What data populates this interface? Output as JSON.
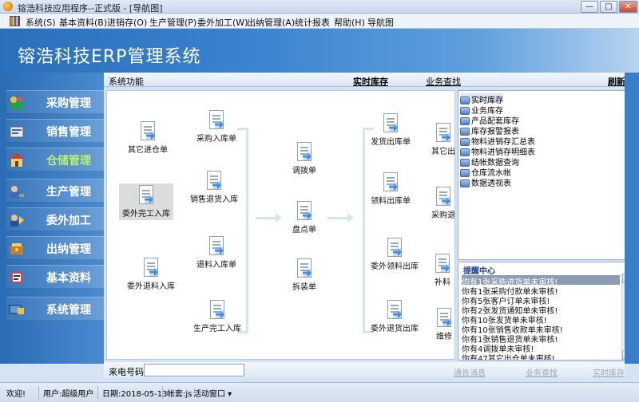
{
  "window": {
    "title": "镕浩科技应用程序--正式版 - [导航图]",
    "btn_min": "—",
    "btn_max": "□",
    "btn_close": "✕"
  },
  "menu": [
    "系统(S)",
    "基本资料(B)",
    "进销存(O)",
    "生产管理(P)",
    "委外加工(W)",
    "出纳管理(A)",
    "统计报表",
    "帮助(H)",
    "导航图"
  ],
  "banner": {
    "title": "镕浩科技ERP管理系统"
  },
  "sidebar": {
    "items": [
      {
        "label": "采购管理",
        "icon": "purchase-icon"
      },
      {
        "label": "销售管理",
        "icon": "sales-icon"
      },
      {
        "label": "仓储管理",
        "icon": "warehouse-icon",
        "active": true
      },
      {
        "label": "生产管理",
        "icon": "production-icon"
      },
      {
        "label": "委外加工",
        "icon": "outsource-icon"
      },
      {
        "label": "出纳管理",
        "icon": "cashier-icon"
      },
      {
        "label": "基本资料",
        "icon": "basic-data-icon"
      },
      {
        "label": "系统管理",
        "icon": "system-icon"
      }
    ]
  },
  "panel_header": {
    "system_function": "系统功能",
    "realtime_stock": "实时库存",
    "business_query": "业务查找",
    "refresh": "刷新"
  },
  "flow": {
    "nodes": [
      "其它进仓单",
      "委外完工入库",
      "委外退料入库",
      "采购入库单",
      "销售退货入库",
      "退料入库单",
      "生产完工入库",
      "调拨单",
      "盘点单",
      "拆装单",
      "发货出库单",
      "领料出库单",
      "委外领料出库",
      "委外退货出库",
      "其它出",
      "采购退",
      "补料",
      "维修"
    ]
  },
  "tree": {
    "items": [
      "实时库存",
      "业务库存",
      "产品配套库存",
      "库存报警报表",
      "物料进销存汇总表",
      "物料进销存明细表",
      "结帐数据查询",
      "仓库流水帐",
      "数据透视表"
    ]
  },
  "reminder": {
    "title": "提醒中心",
    "items": [
      "你有1张采购进货单未审核!",
      "你有1张采购付款单未审核!",
      "你有5张客户订单未审核!",
      "你有2张发货通知单未审核!",
      "你有10张发货单未审核!",
      "你有10张销售收款单未审核!",
      "你有1张销售退货单未审核!",
      "你有4调拨单未审核!",
      "你有47其它出仓单未审核!"
    ]
  },
  "footer": {
    "caller_label": "来电号码:",
    "caller_value": "",
    "links": [
      "通告消息",
      "业务查找",
      "实时库存"
    ]
  },
  "status": {
    "greeting": "欢迎!",
    "user": "用户:超级用户",
    "date": "日期:2018-05-13",
    "account": "帐套:js",
    "active_window": "活动窗口 ▾"
  }
}
